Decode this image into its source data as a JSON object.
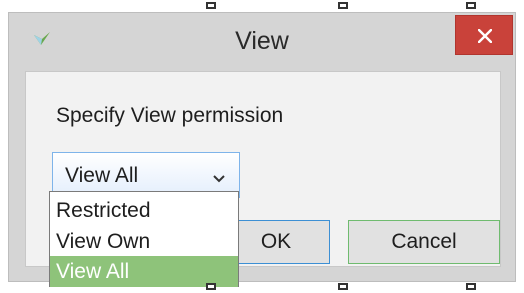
{
  "window": {
    "title": "View",
    "close_icon": "close-icon",
    "app_icon": "app-icon"
  },
  "dialog": {
    "prompt": "Specify View permission",
    "select": {
      "value": "View All",
      "icon": "chevron-down-icon"
    },
    "ok_label": "OK",
    "cancel_label": "Cancel"
  },
  "dropdown": {
    "options": [
      "Restricted",
      "View Own",
      "View All"
    ],
    "highlighted": "View All"
  },
  "colors": {
    "close_button": "#c9423a",
    "highlight": "#8ec37a",
    "select_border": "#7eb4ea"
  }
}
